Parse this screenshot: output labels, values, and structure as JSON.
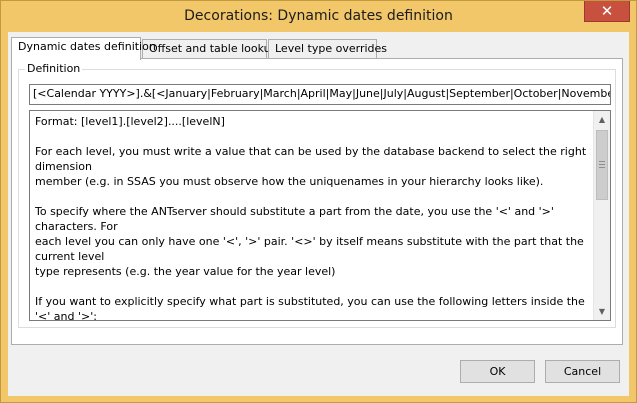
{
  "window": {
    "title": "Decorations: Dynamic dates definition",
    "close_glyph": "✕"
  },
  "tabs": [
    {
      "label": "Dynamic dates definition",
      "active": true
    },
    {
      "label": "Offset and table lookup",
      "active": false
    },
    {
      "label": "Level type overrides",
      "active": false
    }
  ],
  "definition": {
    "label": "Definition",
    "value": "[<Calendar YYYY>].&[<January|February|March|April|May|June|July|August|September|October|November|December>"
  },
  "help_text": "Format: [level1].[level2]....[levelN]\n\nFor each level, you must write a value that can be used by the database backend to select the right dimension\nmember (e.g. in SSAS you must observe how the uniquenames in your hierarchy looks like).\n\nTo specify where the ANTserver should substitute a part from the date, you use the '<' and '>' characters. For\neach level you can only have one '<', '>' pair. '<>' by itself means substitute with the part that the current level\ntype represents (e.g. the year value for the year level)\n\nIf you want to explicitly specify what part is substituted, you can use the following letters inside the '<' and '>':\nY : Year\nX : Week year (what year the current week is part of)\nQ : Quarter\nM : Month\nW : Week\nD : Day of month",
  "scrollbar": {
    "up_glyph": "▲",
    "down_glyph": "▼"
  },
  "buttons": {
    "ok": "OK",
    "cancel": "Cancel"
  },
  "colors": {
    "titlebar": "#f2c76a",
    "close": "#c7503f"
  }
}
